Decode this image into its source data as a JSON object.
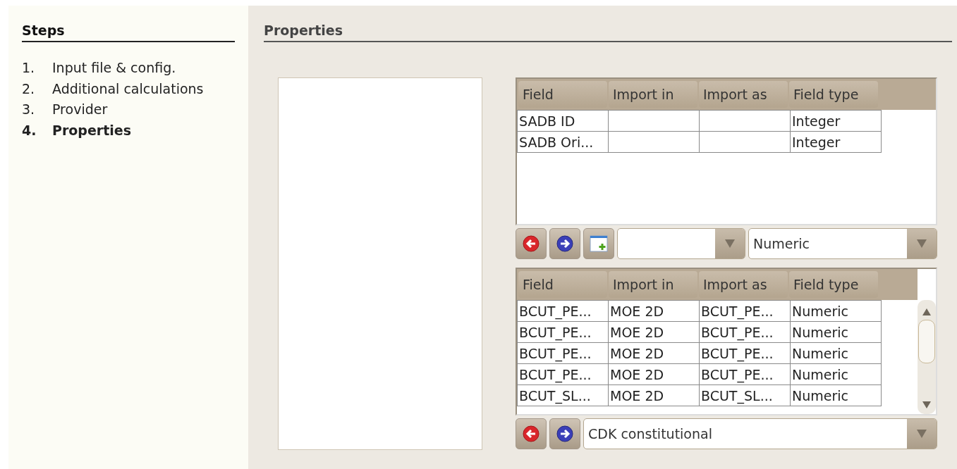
{
  "steps": {
    "title": "Steps",
    "items": [
      {
        "number": "1.",
        "label": "Input file & config.",
        "selected": false
      },
      {
        "number": "2.",
        "label": "Additional calculations",
        "selected": false
      },
      {
        "number": "3.",
        "label": "Provider",
        "selected": false
      },
      {
        "number": "4.",
        "label": "Properties",
        "selected": true
      }
    ]
  },
  "properties": {
    "title": "Properties",
    "table_top": {
      "columns": [
        "Field",
        "Import in",
        "Import as",
        "Field type"
      ],
      "rows": [
        [
          "SADB ID",
          "",
          "",
          "Integer"
        ],
        [
          "SADB Ori...",
          "",
          "",
          "Integer"
        ]
      ]
    },
    "type_dropdown": {
      "value": "Numeric"
    },
    "table_bottom": {
      "columns": [
        "Field",
        "Import in",
        "Import as",
        "Field type"
      ],
      "rows": [
        [
          "BCUT_PE...",
          "MOE 2D",
          "BCUT_PE...",
          "Numeric"
        ],
        [
          "BCUT_PE...",
          "MOE 2D",
          "BCUT_PE...",
          "Numeric"
        ],
        [
          "BCUT_PE...",
          "MOE 2D",
          "BCUT_PE...",
          "Numeric"
        ],
        [
          "BCUT_PE...",
          "MOE 2D",
          "BCUT_PE...",
          "Numeric"
        ],
        [
          "BCUT_SL...",
          "MOE 2D",
          "BCUT_SL...",
          "Numeric"
        ]
      ]
    },
    "descriptor_dropdown": {
      "value": "CDK constitutional"
    }
  }
}
